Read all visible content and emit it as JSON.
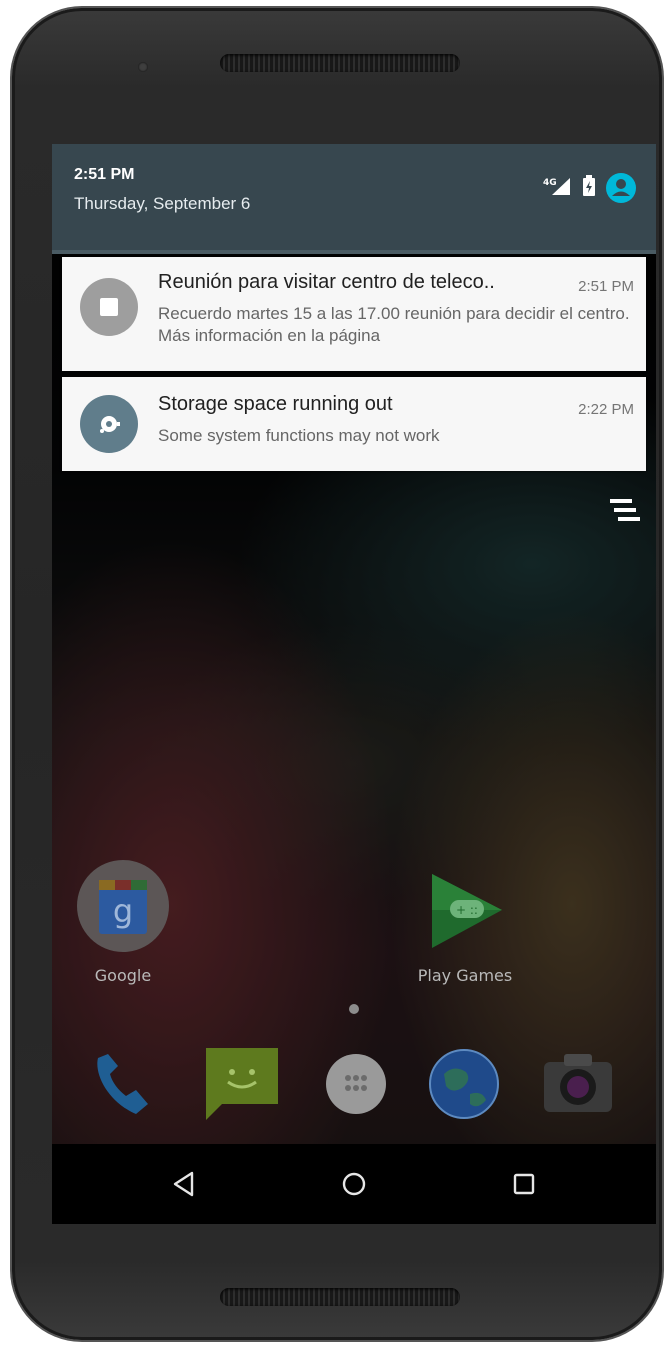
{
  "status": {
    "time": "2:51 PM",
    "date": "Thursday, September 6",
    "signal_label": "4G"
  },
  "notifications": [
    {
      "title": "Reunión para visitar centro de teleco..",
      "time": "2:51 PM",
      "body": "Recuerdo martes 15 a las 17.00 reunión para decidir el centro. Más información en la página",
      "icon": "stop-square-icon"
    },
    {
      "title": "Storage space running out",
      "time": "2:22 PM",
      "body": "Some system functions may not work",
      "icon": "storage-icon"
    }
  ],
  "home": {
    "apps": [
      {
        "label": "Google",
        "icon": "google-search-icon"
      },
      {
        "label": "Play Games",
        "icon": "play-games-icon"
      }
    ],
    "dock": [
      "phone-icon",
      "messaging-icon",
      "app-drawer-icon",
      "browser-icon",
      "camera-icon"
    ]
  },
  "navbar": [
    "back-icon",
    "home-icon",
    "recents-icon"
  ],
  "colors": {
    "status_panel": "#37474f",
    "avatar": "#00b8d9",
    "notification_bg": "#f7f7f7"
  }
}
